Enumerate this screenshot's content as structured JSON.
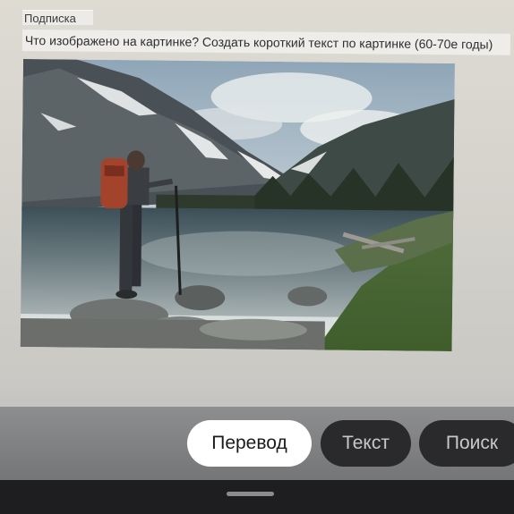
{
  "caption": {
    "label": "Подписка",
    "text": "Что изображено на картинке? Создать короткий текст по картинке (60-70е годы)"
  },
  "photo": {
    "subject": "hiker-at-mountain-lake"
  },
  "actions": {
    "translate_label": "Перевод",
    "text_label": "Текст",
    "search_label": "Поиск",
    "active": "translate"
  },
  "colors": {
    "chip_active_bg": "#ffffff",
    "chip_inactive_bg": "#2a2a2c",
    "navbar_bg": "#1e1e20"
  }
}
